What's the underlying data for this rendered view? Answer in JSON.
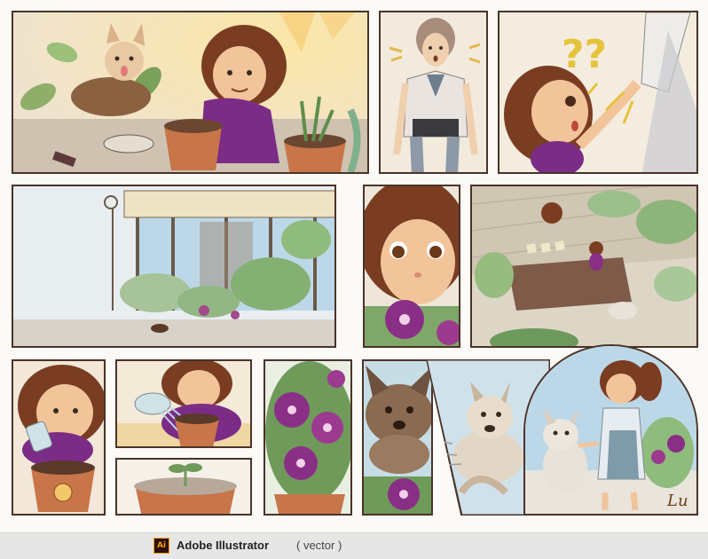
{
  "footer": {
    "icon_label": "Ai",
    "app_name": "Adobe Illustrator",
    "app_type": "( vector )"
  },
  "artwork": {
    "signature": "Lu",
    "question_marks": "??"
  },
  "colors": {
    "ink": "#4a3328",
    "paper": "#fbfaf7",
    "skin": "#f2c49a",
    "hair": "#7a3d22",
    "dress": "#7b2c86",
    "flower": "#8a2f86",
    "leaf": "#6f9a5a",
    "pot": "#c8754a",
    "sky": "#bcd8e8",
    "footer_bg": "#e6e6e6",
    "ai_orange": "#ff9a00",
    "ai_dark": "#2a1205"
  },
  "icons": [
    "illustrator-icon"
  ]
}
